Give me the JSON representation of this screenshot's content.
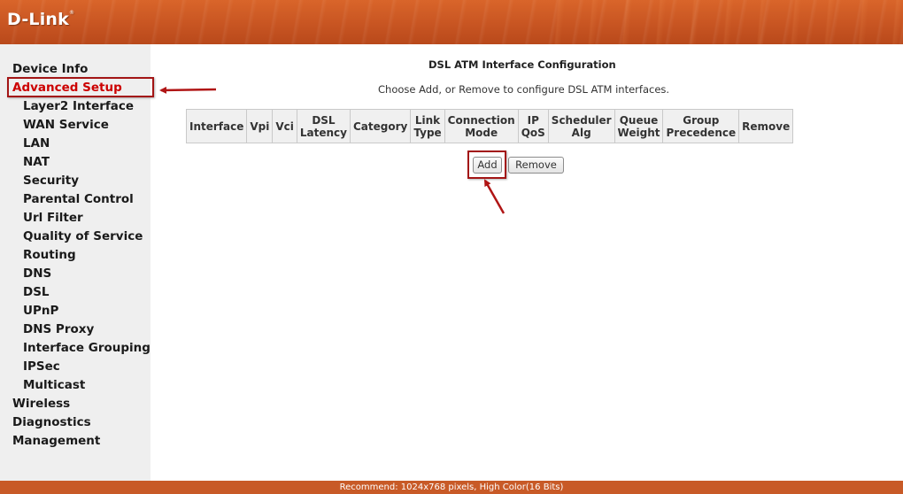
{
  "brand": {
    "logo_text": "D-Link",
    "trademark": "®"
  },
  "colors": {
    "header": "#c85522",
    "footer": "#c85a27",
    "sidebar": "#efefef",
    "active_nav": "#cc0000",
    "highlight": "#a31515"
  },
  "sidebar": {
    "items": [
      {
        "label": "Device Info",
        "level": 0
      },
      {
        "label": "Advanced Setup",
        "level": 0,
        "active": true
      },
      {
        "label": "Layer2 Interface",
        "level": 1
      },
      {
        "label": "WAN Service",
        "level": 1
      },
      {
        "label": "LAN",
        "level": 1
      },
      {
        "label": "NAT",
        "level": 1
      },
      {
        "label": "Security",
        "level": 1
      },
      {
        "label": "Parental Control",
        "level": 1
      },
      {
        "label": "Url Filter",
        "level": 1
      },
      {
        "label": "Quality of Service",
        "level": 1
      },
      {
        "label": "Routing",
        "level": 1
      },
      {
        "label": "DNS",
        "level": 1
      },
      {
        "label": "DSL",
        "level": 1
      },
      {
        "label": "UPnP",
        "level": 1
      },
      {
        "label": "DNS Proxy",
        "level": 1
      },
      {
        "label": "Interface Grouping",
        "level": 1
      },
      {
        "label": "IPSec",
        "level": 1
      },
      {
        "label": "Multicast",
        "level": 1
      },
      {
        "label": "Wireless",
        "level": 0
      },
      {
        "label": "Diagnostics",
        "level": 0
      },
      {
        "label": "Management",
        "level": 0
      }
    ]
  },
  "main": {
    "title": "DSL ATM Interface Configuration",
    "description": "Choose Add, or Remove to configure DSL ATM interfaces.",
    "table": {
      "columns": [
        [
          "Interface"
        ],
        [
          "Vpi"
        ],
        [
          "Vci"
        ],
        [
          "DSL",
          "Latency"
        ],
        [
          "Category"
        ],
        [
          "Link",
          "Type"
        ],
        [
          "Connection",
          "Mode"
        ],
        [
          "IP",
          "QoS"
        ],
        [
          "Scheduler",
          "Alg"
        ],
        [
          "Queue",
          "Weight"
        ],
        [
          "Group",
          "Precedence"
        ],
        [
          "Remove"
        ]
      ],
      "rows": []
    },
    "add_label": "Add",
    "remove_label": "Remove"
  },
  "footer": {
    "text": "Recommend: 1024x768 pixels, High Color(16 Bits)"
  }
}
